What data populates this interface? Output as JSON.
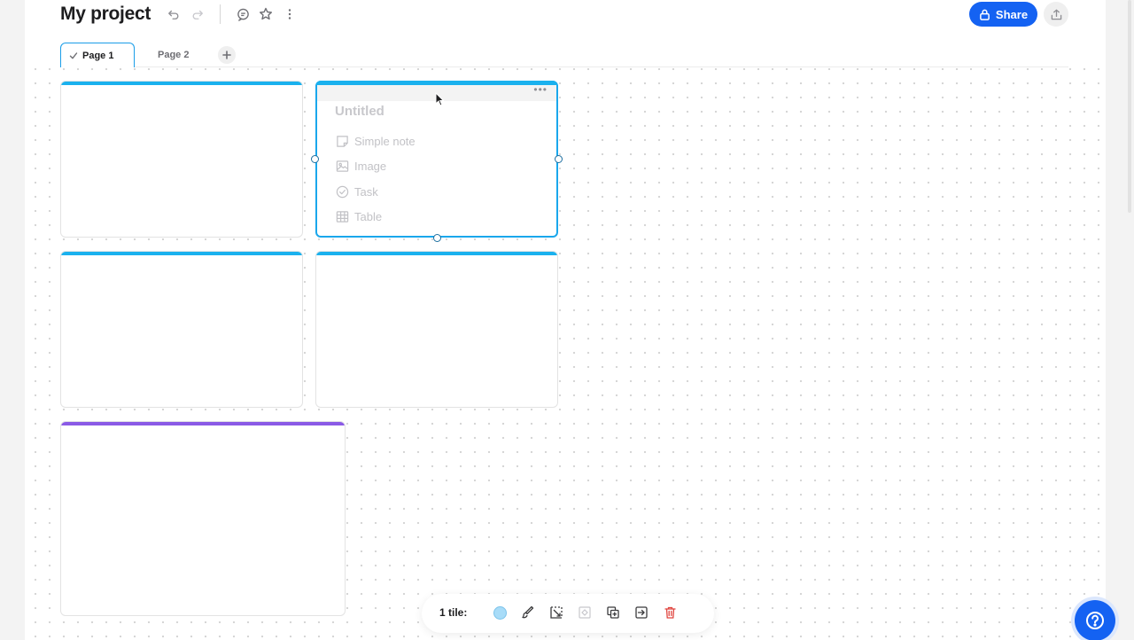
{
  "header": {
    "title": "My project",
    "share_label": "Share",
    "icons": [
      "undo-icon",
      "redo-icon",
      "comment-icon",
      "star-icon",
      "more-vertical-icon",
      "lock-icon",
      "upload-icon"
    ]
  },
  "tabs": [
    {
      "label": "Page 1",
      "active": true
    },
    {
      "label": "Page 2",
      "active": false
    }
  ],
  "tiles": [
    {
      "id": "tile-1",
      "accent": "#1ab1ee"
    },
    {
      "id": "tile-2",
      "accent": "#1ab1ee",
      "selected": true,
      "title": "Untitled",
      "menu": [
        {
          "label": "Simple note",
          "icon": "note-icon"
        },
        {
          "label": "Image",
          "icon": "image-icon"
        },
        {
          "label": "Task",
          "icon": "check-circle-icon"
        },
        {
          "label": "Table",
          "icon": "table-icon"
        }
      ]
    },
    {
      "id": "tile-3",
      "accent": "#1ab1ee"
    },
    {
      "id": "tile-4",
      "accent": "#1ab1ee"
    },
    {
      "id": "tile-5",
      "accent": "#8a5ae6"
    }
  ],
  "toolbar": {
    "selection_label": "1 tile:",
    "tile_color": "#a8dcf8",
    "buttons": [
      "color-swatch",
      "brush-icon",
      "resize-icon",
      "fit-icon",
      "duplicate-icon",
      "move-icon",
      "delete-icon"
    ]
  },
  "colors": {
    "primary": "#1462f2",
    "tile_accent": "#1ab1ee",
    "purple_accent": "#8a5ae6",
    "danger": "#e0453f"
  }
}
